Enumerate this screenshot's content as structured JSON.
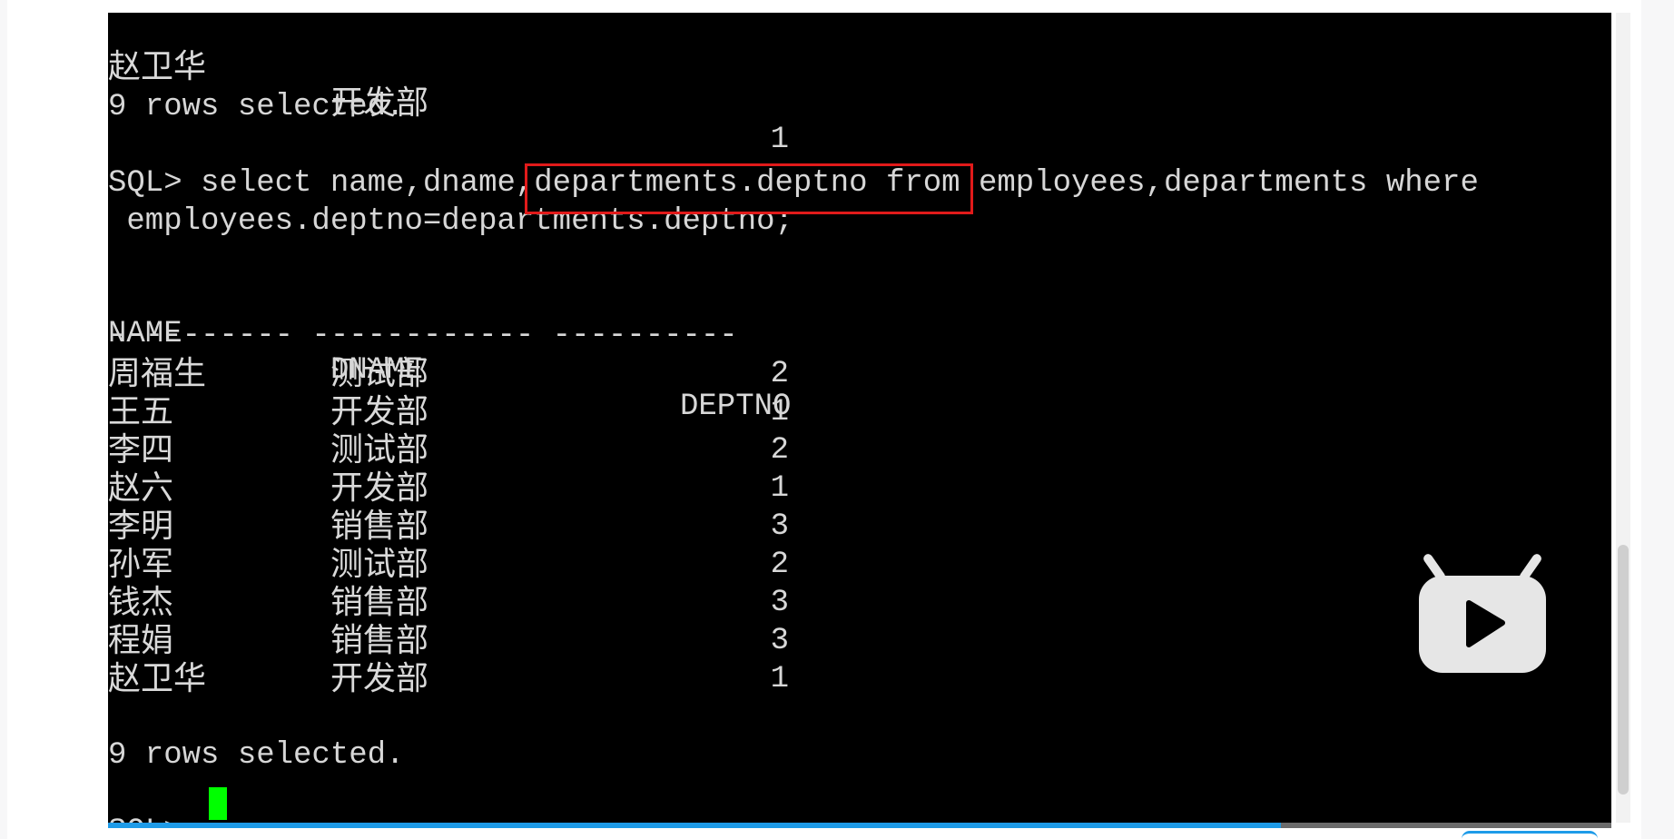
{
  "terminal": {
    "prev_last_row": {
      "name": "赵卫华",
      "dname": "开发部",
      "deptno": "1"
    },
    "prev_rows_selected": "9 rows selected.",
    "query_line1": "SQL> select name,dname,departments.deptno from employees,departments where",
    "query_line2": " employees.deptno=departments.deptno;",
    "headers": {
      "name": "NAME",
      "dname": "DNAME",
      "deptno": "DEPTNO"
    },
    "separator": "---------- ------------ ----------",
    "rows": [
      {
        "name": "周福生",
        "dname": "测试部",
        "deptno": "2"
      },
      {
        "name": "王五",
        "dname": "开发部",
        "deptno": "1"
      },
      {
        "name": "李四",
        "dname": "测试部",
        "deptno": "2"
      },
      {
        "name": "赵六",
        "dname": "开发部",
        "deptno": "1"
      },
      {
        "name": "李明",
        "dname": "销售部",
        "deptno": "3"
      },
      {
        "name": "孙军",
        "dname": "测试部",
        "deptno": "2"
      },
      {
        "name": "钱杰",
        "dname": "销售部",
        "deptno": "3"
      },
      {
        "name": "程娟",
        "dname": "销售部",
        "deptno": "3"
      },
      {
        "name": "赵卫华",
        "dname": "开发部",
        "deptno": "1"
      }
    ],
    "rows_selected": "9 rows selected.",
    "prompt": "SQL> "
  },
  "player": {
    "progress_fraction": 0.78,
    "logo_icon": "bilibili-tv-icon"
  },
  "colors": {
    "terminal_bg": "#000000",
    "terminal_text": "#d7d7d7",
    "cursor": "#00ff00",
    "highlight": "#e11a1a",
    "progress": "#1e9be8"
  }
}
